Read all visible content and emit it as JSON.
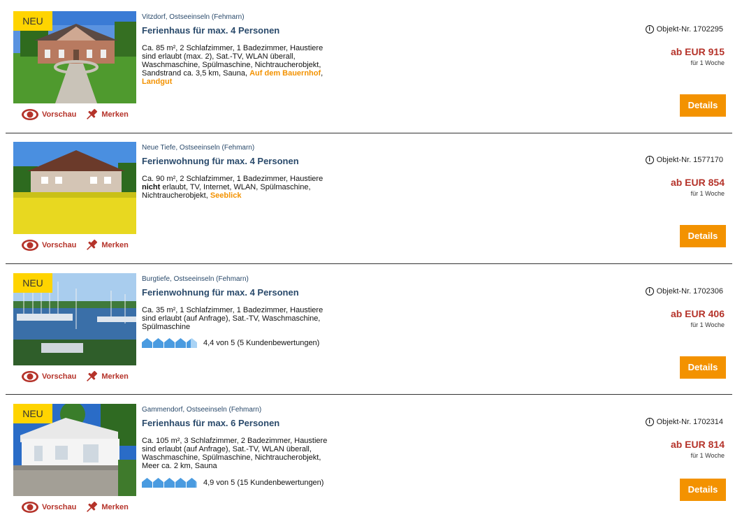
{
  "colors": {
    "accent": "#f39200",
    "price": "#b5332a",
    "title": "#2a4a6b",
    "badge": "#ffd400"
  },
  "common": {
    "vorschau_label": "Vorschau",
    "merken_label": "Merken",
    "details_label": "Details",
    "neu_label": "NEU",
    "per_week": "für 1 Woche"
  },
  "listings": [
    {
      "location": "Vitzdorf, Ostseeinseln (Fehmarn)",
      "title": "Ferienhaus für max. 4 Personen",
      "desc_text": "Ca. 85 m², 2 Schlafzimmer, 1 Badezimmer, Haustiere sind erlaubt (max. 2), Sat.-TV, WLAN überall, Waschmaschine, Spülmaschine, Nichtraucherobjekt, Sandstrand ca. 3,5 km, Sauna, ",
      "desc_highlight": "Auf dem Bauernhof",
      "desc_highlight_sep": ", ",
      "desc_highlight2": "Landgut",
      "objekt_nr": "Objekt-Nr. 1702295",
      "price": "ab EUR 915",
      "is_new": true
    },
    {
      "location": "Neue Tiefe, Ostseeinseln (Fehmarn)",
      "title": "Ferienwohnung für max. 4 Personen",
      "desc_text": "Ca. 90 m², 2 Schlafzimmer, 1 Badezimmer, Haustiere ",
      "desc_bold": "nicht",
      "desc_text2": " erlaubt, TV, Internet, WLAN, Spülmaschine, Nichtraucherobjekt, ",
      "desc_highlight": "Seeblick",
      "objekt_nr": "Objekt-Nr. 1577170",
      "price": "ab EUR 854",
      "is_new": false
    },
    {
      "location": "Burgtiefe, Ostseeinseln (Fehmarn)",
      "title": "Ferienwohnung für max. 4 Personen",
      "desc_text": "Ca. 35 m², 1 Schlafzimmer, 1 Badezimmer, Haustiere sind erlaubt (auf Anfrage), Sat.-TV, Waschmaschine, Spülmaschine",
      "rating_text": "4,4 von 5 (5 Kundenbewertungen)",
      "rating_value": 4.4,
      "objekt_nr": "Objekt-Nr. 1702306",
      "price": "ab EUR 406",
      "is_new": true
    },
    {
      "location": "Gammendorf, Ostseeinseln (Fehmarn)",
      "title": "Ferienhaus für max. 6 Personen",
      "desc_text": "Ca. 105 m², 3 Schlafzimmer, 2 Badezimmer, Haustiere sind erlaubt (auf Anfrage), Sat.-TV, WLAN überall, Waschmaschine, Spülmaschine, Nichtraucherobjekt, Meer ca. 2 km, Sauna",
      "rating_text": "4,9 von 5 (15 Kundenbewertungen)",
      "rating_value": 4.9,
      "objekt_nr": "Objekt-Nr. 1702314",
      "price": "ab EUR 814",
      "is_new": true
    }
  ]
}
